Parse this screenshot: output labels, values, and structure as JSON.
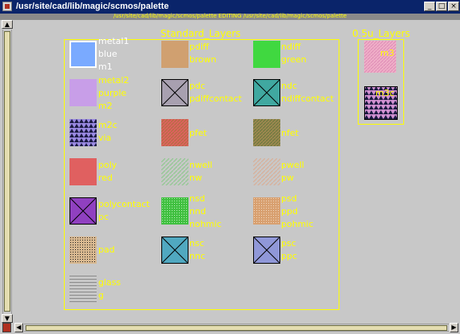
{
  "window": {
    "title": "/usr/site/cad/lib/magic/scmos/palette",
    "minimize": "_",
    "maximize": "□",
    "close": "×"
  },
  "caption": "/usr/site/cad/lib/magic/scmos/palette EDITING /usr/site/cad/lib/magic/scmos/palette",
  "groups": {
    "standard": "Standard_Layers",
    "pointfive": "0.5u_Layers"
  },
  "layers": {
    "metal1": [
      "metal1",
      "blue",
      "m1"
    ],
    "metal2": [
      "metal2",
      "purple",
      "m2"
    ],
    "m2c": [
      "m2c",
      "via"
    ],
    "poly": [
      "poly",
      "red"
    ],
    "polycontact": [
      "polycontact",
      "pc"
    ],
    "pad": [
      "pad"
    ],
    "glass": [
      "glass",
      "g"
    ],
    "pdiff": [
      "pdiff",
      "brown"
    ],
    "pdc": [
      "pdc",
      "pdiffcontact"
    ],
    "pfet": [
      "pfet"
    ],
    "nwell": [
      "nwell",
      "nw"
    ],
    "nsd": [
      "nsd",
      "nnd",
      "nohmic"
    ],
    "nsc": [
      "nsc",
      "nnc"
    ],
    "ndiff": [
      "ndiff",
      "green"
    ],
    "ndc": [
      "ndc",
      "ndiffcontact"
    ],
    "nfet": [
      "nfet"
    ],
    "pwell": [
      "pwell",
      "pw"
    ],
    "psd": [
      "psd",
      "ppd",
      "pohmic"
    ],
    "psc": [
      "psc",
      "ppc"
    ],
    "m3": [
      "m3"
    ],
    "m3c": [
      "m3c"
    ]
  },
  "colors": {
    "background": "#c8c8c8",
    "label": "#ffff00",
    "titlebar": "#0a246a"
  }
}
